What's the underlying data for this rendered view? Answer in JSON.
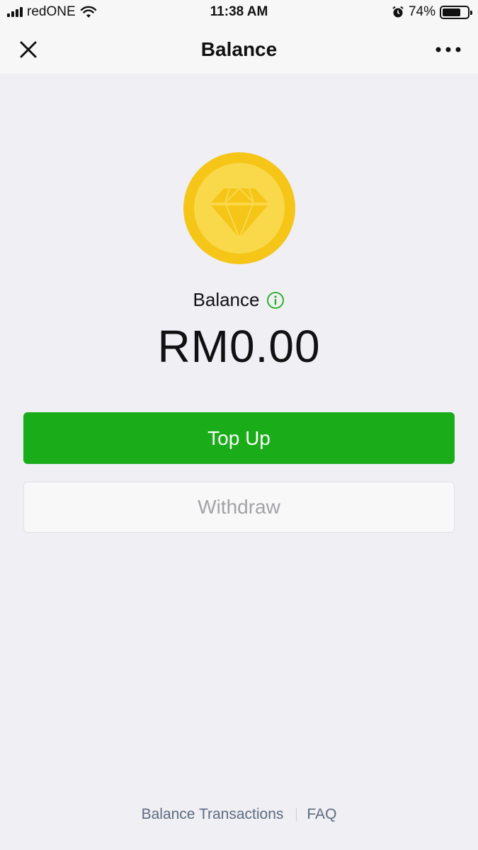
{
  "status_bar": {
    "carrier": "redONE",
    "time": "11:38 AM",
    "battery_percent_label": "74%",
    "battery_level": 0.74,
    "icons": [
      "signal-icon",
      "wifi-icon",
      "alarm-icon",
      "battery-icon"
    ]
  },
  "nav": {
    "title": "Balance",
    "close_icon": "close-icon",
    "more_icon": "more-icon"
  },
  "wallet": {
    "coin_icon": "diamond-coin-icon",
    "balance_label": "Balance",
    "info_icon": "info-icon",
    "amount": "RM0.00"
  },
  "actions": {
    "top_up_label": "Top Up",
    "withdraw_label": "Withdraw"
  },
  "footer": {
    "transactions_label": "Balance Transactions",
    "faq_label": "FAQ"
  },
  "colors": {
    "primary_green": "#1aad19",
    "background": "#efeff4",
    "coin_yellow": "#f5c518",
    "link_color": "#5e6b80"
  }
}
